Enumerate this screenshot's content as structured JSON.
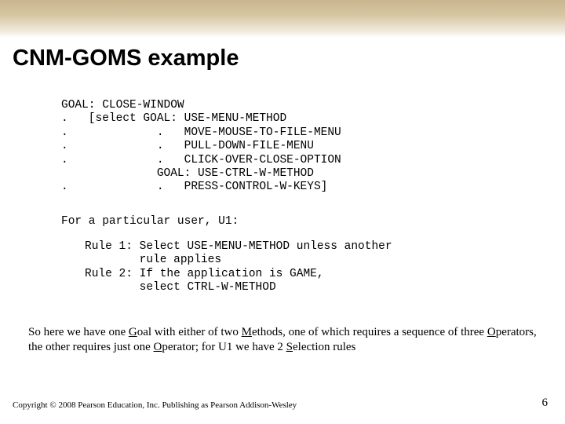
{
  "title": "CNM-GOMS example",
  "code": "GOAL: CLOSE-WINDOW\n.   [select GOAL: USE-MENU-METHOD\n.             .   MOVE-MOUSE-TO-FILE-MENU\n.             .   PULL-DOWN-FILE-MENU\n.             .   CLICK-OVER-CLOSE-OPTION\n              GOAL: USE-CTRL-W-METHOD\n.             .   PRESS-CONTROL-W-KEYS]",
  "rules_intro": "For a particular user, U1:",
  "rules": "Rule 1: Select USE-MENU-METHOD unless another\n        rule applies\nRule 2: If the application is GAME,\n        select CTRL-W-METHOD",
  "body": {
    "t0": "So here we have one ",
    "g": "G",
    "t1": "oal with either of two ",
    "m": "M",
    "t2": "ethods, one of which requires a sequence of three ",
    "o1": "O",
    "t3": "perators, the other requires just one ",
    "o2": "O",
    "t4": "perator; for U1 we have 2 ",
    "s": "S",
    "t5": "election rules"
  },
  "footer": {
    "copyright": "Copyright © 2008 Pearson Education, Inc. Publishing as Pearson Addison-Wesley",
    "page": "6"
  }
}
